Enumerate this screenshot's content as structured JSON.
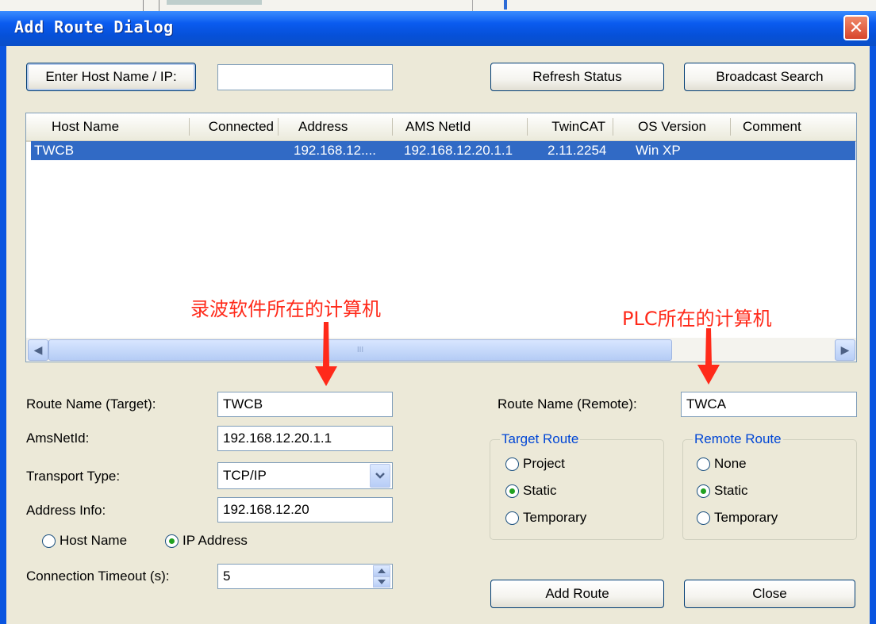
{
  "window": {
    "title": "Add Route Dialog",
    "close_glyph": "✕"
  },
  "toolbar": {
    "enter_host_label": "Enter Host Name / IP:",
    "host_input_value": "",
    "refresh_label": "Refresh Status",
    "broadcast_label": "Broadcast Search"
  },
  "table": {
    "columns": [
      "Host Name",
      "Connected",
      "Address",
      "AMS NetId",
      "TwinCAT",
      "OS Version",
      "Comment"
    ],
    "rows": [
      {
        "host_name": "TWCB",
        "connected": "",
        "address": "192.168.12....",
        "ams_netid": "192.168.12.20.1.1",
        "twincat": "2.11.2254",
        "os_version": "Win XP",
        "comment": ""
      }
    ]
  },
  "scrollbar": {
    "left_glyph": "◀",
    "right_glyph": "▶",
    "grip": "III"
  },
  "form": {
    "route_name_target_label": "Route Name (Target):",
    "route_name_target_value": "TWCB",
    "amsnetid_label": "AmsNetId:",
    "amsnetid_value": "192.168.12.20.1.1",
    "transport_label": "Transport Type:",
    "transport_value": "TCP/IP",
    "address_info_label": "Address Info:",
    "address_info_value": "192.168.12.20",
    "radio_host_name": "Host Name",
    "radio_ip_address": "IP Address",
    "timeout_label": "Connection Timeout (s):",
    "timeout_value": "5",
    "route_name_remote_label": "Route Name (Remote):",
    "route_name_remote_value": "TWCA"
  },
  "target_route": {
    "title": "Target Route",
    "options": [
      "Project",
      "Static",
      "Temporary"
    ],
    "selected": "Static"
  },
  "remote_route": {
    "title": "Remote Route",
    "options": [
      "None",
      "Static",
      "Temporary"
    ],
    "selected": "Static"
  },
  "actions": {
    "add_route_label": "Add Route",
    "close_label": "Close"
  },
  "annotations": {
    "left": "录波软件所在的计算机",
    "right": "PLC所在的计算机"
  },
  "colors": {
    "title_bar": "#0a5bef",
    "selection": "#316ac5",
    "annotation": "#ff2a1a",
    "group_title": "#0046d5"
  }
}
